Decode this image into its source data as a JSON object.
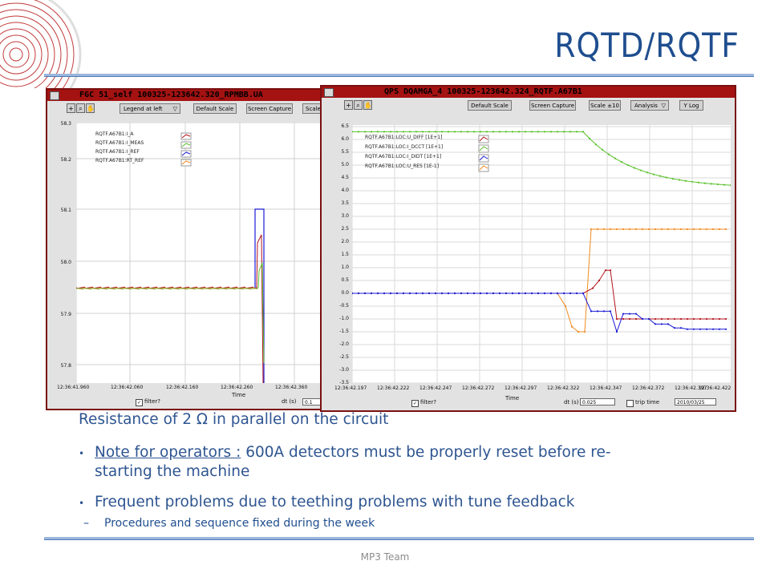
{
  "slide": {
    "title": "RQTD/RQTF",
    "footer": "MP3 Team"
  },
  "left_window": {
    "title": "FGC  51_self  100325-123642.320_RPMBB.UA",
    "toolbar": {
      "legend_select": "Legend at left",
      "default_scale": "Default Scale",
      "screen_capture": "Screen Capture",
      "scale": "Scale"
    },
    "legend": [
      "RQTF.A67B1:I_A",
      "RQTF.A67B1:I_MEAS",
      "RQTF.A67B1:I_REF",
      "RQTF.A67B1:RT_REF"
    ],
    "y_ticks": [
      "58.3",
      "58.2",
      "58.1",
      "58.0",
      "57.9",
      "57.8"
    ],
    "x_ticks": [
      "12:36:41.960",
      "12:36:41.960",
      "12:36:42.060",
      "12:36:42.160",
      "12:36:42.260",
      "12:36:42.360",
      "12:36:4"
    ],
    "x_label": "Time",
    "filter_label": "filter?",
    "dt_label": "dt (s)",
    "dt_value": "0.1"
  },
  "right_window": {
    "title": "QPS  DQAMGA_4  100325-123642.324_RQTF.A67B1",
    "toolbar": {
      "default_scale": "Default Scale",
      "screen_capture": "Screen Capture",
      "scale10": "Scale ±10",
      "analysis": "Analysis",
      "ylog": "Y Log"
    },
    "legend": [
      "RQTF.A67B1:LOC:U_DIFF [1E+1]",
      "RQTF.A67B1:LOC:I_DCCT [1E+1]",
      "RQTF.A67B1:LOC:I_DIDT [1E+1]",
      "RQTF.A67B1:LOC:U_RES [1E-1]"
    ],
    "y_ticks": [
      "6.5",
      "6.0",
      "5.5",
      "5.0",
      "4.5",
      "4.0",
      "3.5",
      "3.0",
      "2.5",
      "2.0",
      "1.5",
      "1.0",
      "0.5",
      "0.0",
      "-0.5",
      "-1.0",
      "-1.5",
      "-2.0",
      "-2.5",
      "-3.0",
      "-3.5"
    ],
    "x_ticks": [
      "12:36:42.197",
      "12:36:42.222",
      "12:36:42.247",
      "12:36:42.272",
      "12:36:42.297",
      "12:36:42.322",
      "12:36:42.347",
      "12:36:42.372",
      "12:36:42.397",
      "12:36:42.422"
    ],
    "x_label": "Time",
    "filter_label": "filter?",
    "dt_label": "dt (s)",
    "dt_value": "0.025",
    "trip_label": "trip time",
    "date_value": "2010/03/25"
  },
  "body": {
    "intro": "Resistance of 2 Ω in parallel on the circuit",
    "bullet1_underlined": "Note for operators :",
    "bullet1_rest": " 600A detectors must be properly reset before re-",
    "bullet1_cont": "starting the machine",
    "bullet2": "Frequent problems due to teething problems with tune feedback",
    "sub1": "Procedures and sequence fixed during the week",
    "dash": "–"
  },
  "colors": {
    "accent": "#1f4e8f",
    "titlebar": "#a41212",
    "trace_green": "#59c02a",
    "trace_orange": "#f08a1e",
    "trace_blue": "#1b1bd6",
    "trace_red": "#b2141c"
  }
}
